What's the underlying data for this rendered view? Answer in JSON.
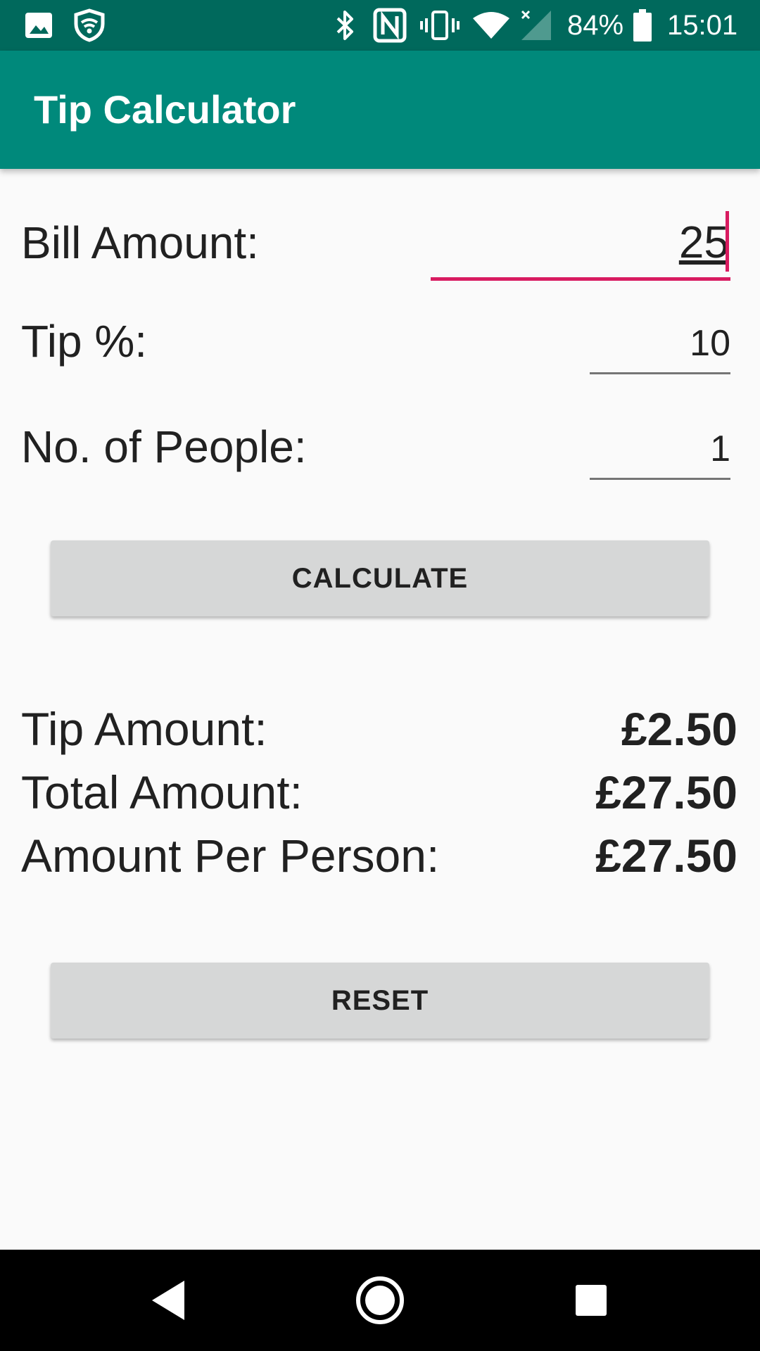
{
  "status_bar": {
    "battery": "84%",
    "time": "15:01",
    "icons": [
      "gallery-icon",
      "shield-icon",
      "bluetooth-icon",
      "nfc-icon",
      "vibrate-icon",
      "wifi-icon",
      "signal-icon",
      "battery-icon"
    ]
  },
  "app_bar": {
    "title": "Tip Calculator",
    "color": "#00897b"
  },
  "form": {
    "bill_label": "Bill Amount:",
    "bill_value": "25",
    "tip_label": "Tip %:",
    "tip_value": "10",
    "people_label": "No. of People:",
    "people_value": "1"
  },
  "buttons": {
    "calculate": "CALCULATE",
    "reset": "RESET"
  },
  "results": {
    "tip_label": "Tip Amount:",
    "tip_value": "£2.50",
    "total_label": "Total Amount:",
    "total_value": "£27.50",
    "per_person_label": "Amount Per Person:",
    "per_person_value": "£27.50"
  },
  "nav_bar": {
    "icons": [
      "back-icon",
      "home-icon",
      "recents-icon"
    ]
  },
  "colors": {
    "status_bar": "#00695c",
    "accent": "#d81b60",
    "button": "#d6d7d7"
  }
}
